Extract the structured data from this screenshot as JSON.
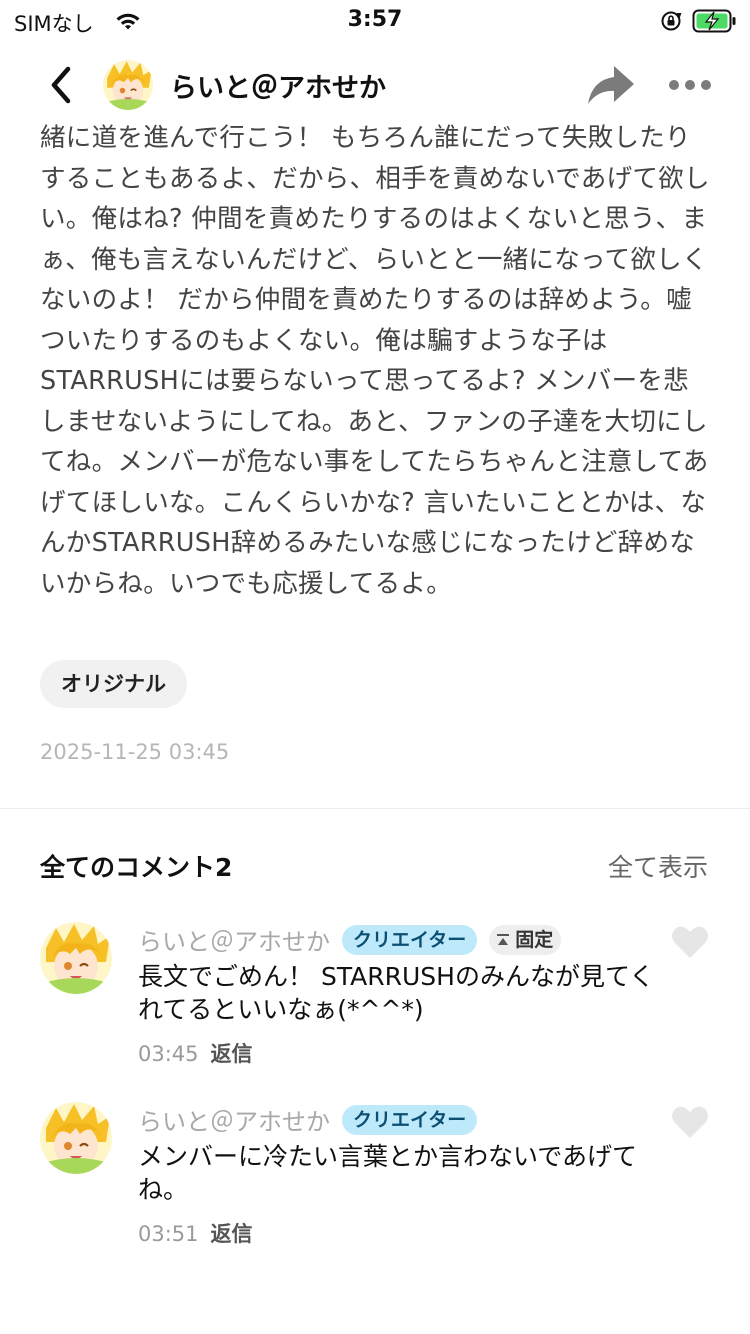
{
  "status_bar": {
    "carrier": "SIMなし",
    "time": "3:57"
  },
  "header": {
    "title": "らいと＠アホせか"
  },
  "post": {
    "body": "緒に道を進んで行こう！ もちろん誰にだって失敗したりすることもあるよ、だから、相手を責めないであげて欲しい。俺はね? 仲間を責めたりするのはよくないと思う、まぁ、俺も言えないんだけど、らいとと一緒になって欲しくないのよ！ だから仲間を責めたりするのは辞めよう。嘘ついたりするのもよくない。俺は騙すような子はSTARRUSHには要らないって思ってるよ? メンバーを悲しませないようにしてね。あと、ファンの子達を大切にしてね。メンバーが危ない事をしてたらちゃんと注意してあげてほしいな。こんくらいかな? 言いたいこととかは、なんかSTARRUSH辞めるみたいな感じになったけど辞めないからね。いつでも応援してるよ。",
    "tag": "オリジナル",
    "date": "2025-11-25 03:45"
  },
  "comments_section": {
    "heading": "全てのコメント2",
    "show_all": "全て表示",
    "items": [
      {
        "author": "らいと＠アホせか",
        "badge": "クリエイター",
        "pinned_label": "固定",
        "text": "長文でごめん！ STARRUSHのみんなが見てくれてるといいなぁ(*^^*)",
        "time": "03:45",
        "reply": "返信"
      },
      {
        "author": "らいと＠アホせか",
        "badge": "クリエイター",
        "text": "メンバーに冷たい言葉とか言わないであげてね。",
        "time": "03:51",
        "reply": "返信"
      }
    ]
  },
  "colors": {
    "creator_badge_bg": "#bde9fb",
    "battery_green": "#4cd964"
  },
  "icons": [
    "wifi-icon",
    "orientation-lock-icon",
    "battery-charging-icon",
    "back-arrow-icon",
    "share-icon",
    "more-icon",
    "pin-icon",
    "heart-icon"
  ]
}
